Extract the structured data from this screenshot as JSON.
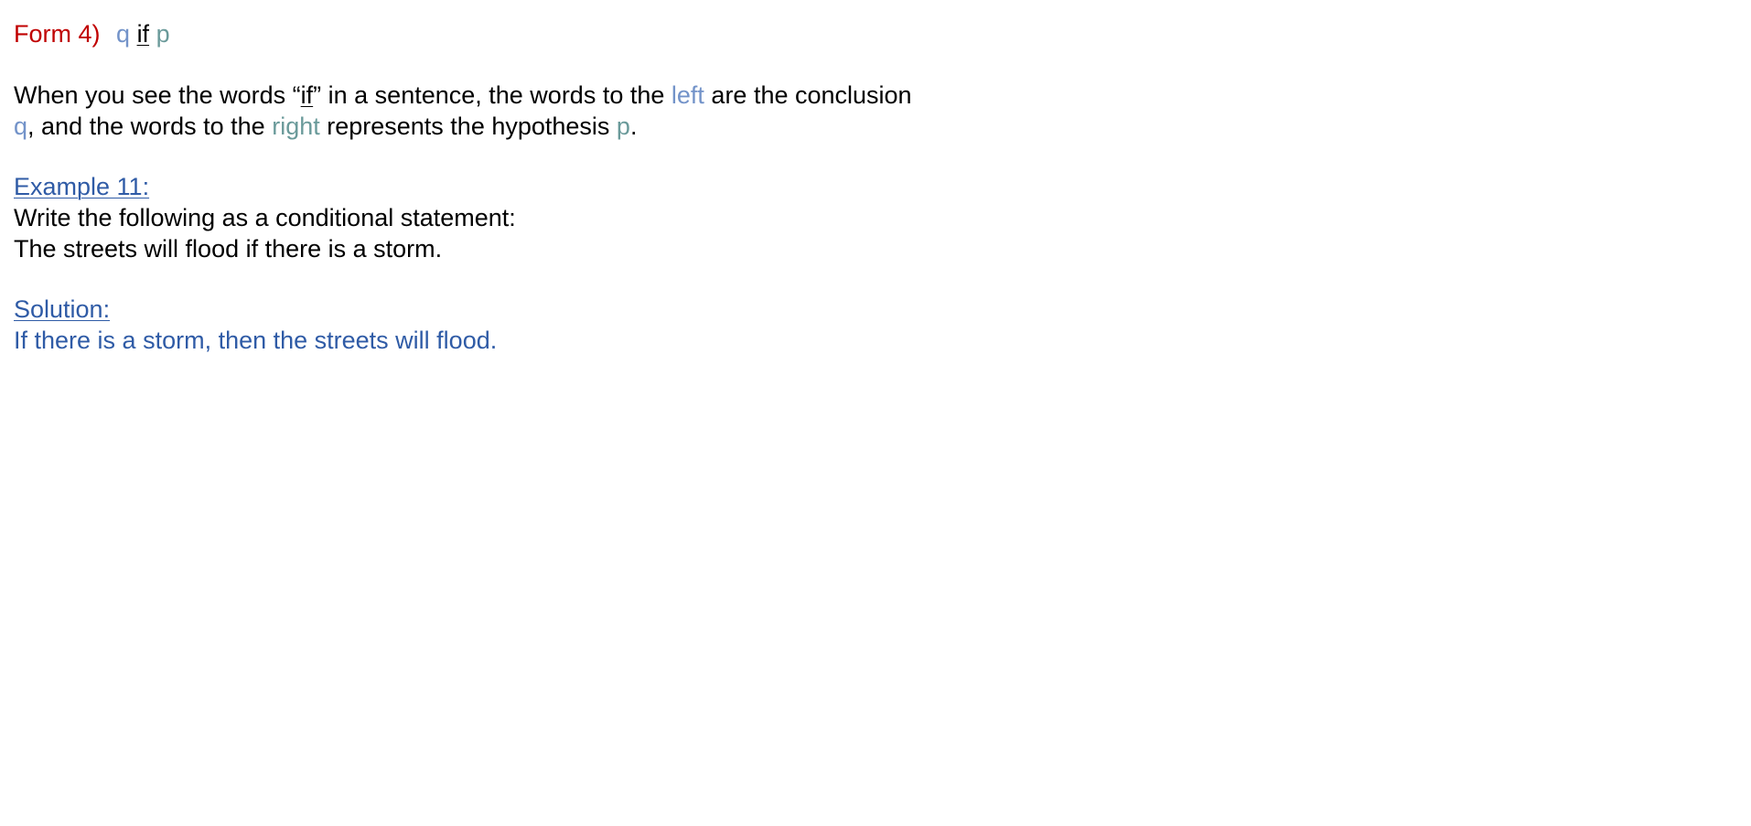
{
  "form_heading": {
    "label": "Form 4)",
    "q": "q",
    "if": "if",
    "p": "p"
  },
  "explanation": {
    "line1_a": "When you see the words “",
    "line1_if": "if",
    "line1_b": "” in a sentence, the words to the ",
    "line1_left": "left",
    "line1_c": " are the conclusion",
    "line2_q": "q",
    "line2_a": ", and the words to the ",
    "line2_right": "right",
    "line2_b": " represents the hypothesis ",
    "line2_p": "p",
    "line2_end": "."
  },
  "example": {
    "heading": "Example 11:",
    "prompt": "Write the following as a conditional statement:",
    "statement": "The streets will flood if there is a storm."
  },
  "solution": {
    "heading": "Solution:",
    "answer": "If there is a storm, then the streets will flood."
  },
  "colors": {
    "heading_red": "#c00000",
    "conclusion_blue": "#7393c9",
    "hypothesis_teal": "#6a9a9a",
    "link_blue": "#2f5ba6"
  }
}
